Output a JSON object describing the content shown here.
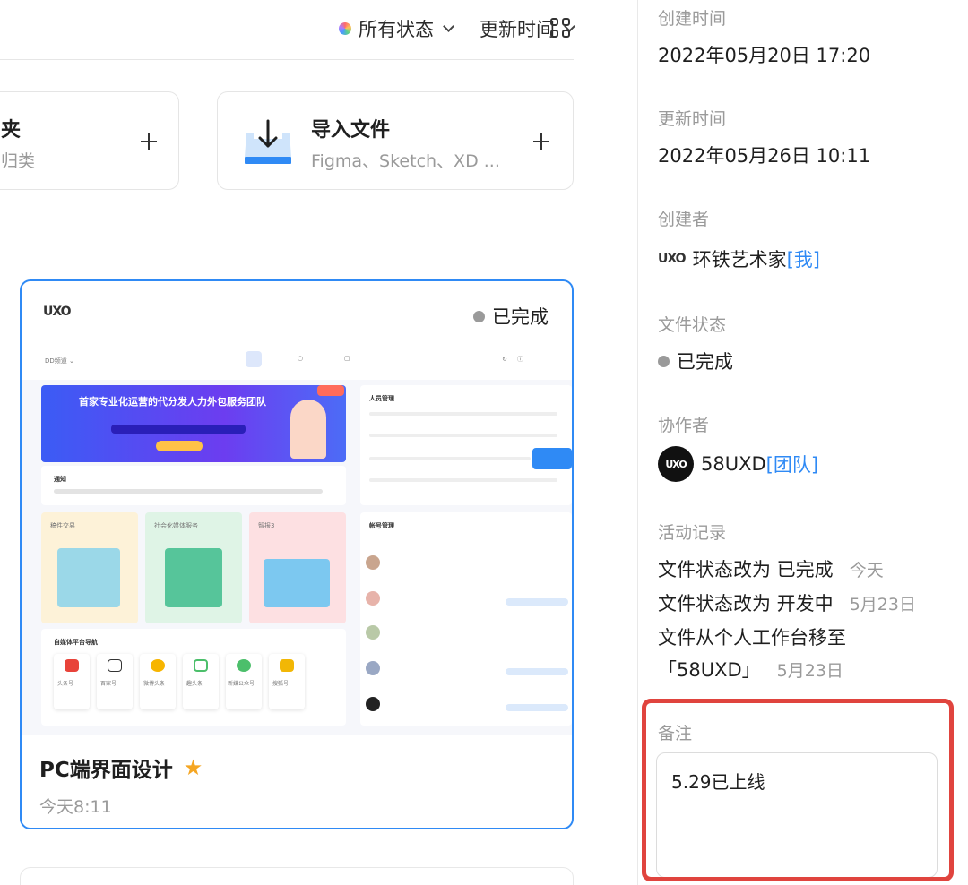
{
  "toolbar": {
    "status_filter": "所有状态",
    "sort_filter": "更新时间"
  },
  "actions": {
    "new_folder_title": "夹",
    "new_folder_sub": "归类",
    "import_title": "导入文件",
    "import_sub": "Figma、Sketch、XD ..."
  },
  "project": {
    "logo": "UXO",
    "status": "已完成",
    "name": "PC端界面设计",
    "time": "今天8:11"
  },
  "preview": {
    "banner_title": "首家专业化运营的代分发人力外包服务团队",
    "notice": "通知",
    "section_people": "人员管理",
    "section_account": "帐号管理",
    "card1": "稿件交易",
    "card2": "社会化媒体服务",
    "card3": "智报3",
    "platform_title": "自媒体平台导航",
    "platforms": [
      "头条号",
      "百家号",
      "微博头条",
      "趣头条",
      "新媒公众号",
      "搜狐号"
    ]
  },
  "panel": {
    "created_label": "创建时间",
    "created_value": "2022年05月20日 17:20",
    "updated_label": "更新时间",
    "updated_value": "2022年05月26日 10:11",
    "creator_label": "创建者",
    "creator_logo": "UXO",
    "creator_name": "环铁艺术家",
    "creator_tag": "[我]",
    "status_label": "文件状态",
    "status_value": "已完成",
    "collab_label": "协作者",
    "collab_avatar": "UXO",
    "collab_name": "58UXD",
    "collab_tag": "[团队]",
    "activity_label": "活动记录",
    "activity": [
      {
        "text": "文件状态改为 已完成",
        "time": "今天"
      },
      {
        "text": "文件状态改为 开发中",
        "time": "5月23日"
      },
      {
        "text": "文件从个人工作台移至",
        "time": ""
      },
      {
        "text": "「58UXD」",
        "time": "5月23日"
      }
    ],
    "note_label": "备注",
    "note_value": "5.29已上线"
  },
  "colors": {
    "accent": "#2f8af5",
    "highlight": "#e0443e",
    "star": "#f5a623"
  }
}
